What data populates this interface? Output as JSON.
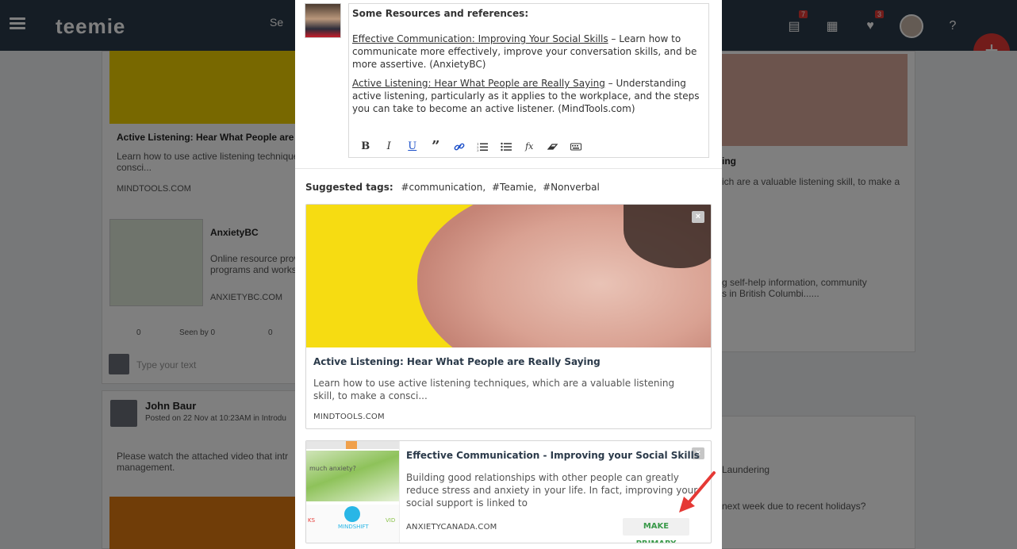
{
  "app": {
    "logo": "teemie",
    "search_placeholder": "Se",
    "notifications_badge": "7",
    "messages_badge": "3"
  },
  "background_feed": {
    "left_card1_title": "Active Listening: Hear What People are Rea",
    "left_card1_desc": "Learn how to use active listening techniques,\nconsci...",
    "left_card1_src": "MINDTOOLS.COM",
    "left_card2_title": "AnxietyBC",
    "left_card2_desc": "Online resource prov\nprograms and works",
    "left_card2_src": "ANXIETYBC.COM",
    "likes": "0",
    "seen_by": "Seen by 0",
    "comments": "0",
    "comment_placeholder": "Type your text",
    "post_author": "John Baur",
    "post_meta": "Posted on 22 Nov at 10:23AM in Introdu",
    "post_text": "Please watch the attached video that intr\nmanagement.",
    "right_card1_title": "ing",
    "right_card1_desc": "ich are a valuable listening skill, to make a",
    "right_card2_desc": "g self-help information, community\ns in British Columbi......",
    "right_snip1": "Laundering",
    "right_snip2": "next week due to recent holidays?"
  },
  "editor": {
    "heading": "Some Resources and references:",
    "link1_text": "Effective Communication: Improving Your Social Skills",
    "link1_rest": " – Learn how to communicate more effectively, improve your conversation skills, and be more assertive. (AnxietyBC)",
    "link2_text": "Active Listening: Hear What People are Really Saying",
    "link2_rest": " – Understanding active listening, particularly as it applies to the workplace, and the steps you can take to become an active listener. (MindTools.com)",
    "toolbar": {
      "bold": "B",
      "italic": "I",
      "underline": "U",
      "quote": "”",
      "link": "🔗",
      "ordered_list": "☰",
      "bullet_list": "☰",
      "formula": "fx",
      "clear": "⌫",
      "keyboard": "⌨"
    }
  },
  "tags": {
    "label": "Suggested tags:",
    "items": [
      "#communication,",
      "#Teamie,",
      "#Nonverbal"
    ]
  },
  "preview_cards": [
    {
      "title": "Active Listening: Hear What People are Really Saying",
      "description": "Learn how to use active listening techniques, which are a valuable listening skill, to make a consci...",
      "source": "MINDTOOLS.COM",
      "close": "×"
    },
    {
      "title": "Effective Communication - Improving your Social Skills",
      "description": "Building good relationships with other people can greatly reduce stress and anxiety in your life. In fact, improving your social support is linked to",
      "source": "ANXIETYCANADA.COM",
      "close": "×",
      "action": "MAKE PRIMARY",
      "thumb_text": "much anxiety?",
      "thumb_label": "MINDSHIFT",
      "thumb_left": "KS",
      "thumb_right": "VID"
    }
  ],
  "colors": {
    "accent_red": "#e53935",
    "make_primary_green": "#3a9a4a",
    "topbar": "#2b3a4a"
  }
}
